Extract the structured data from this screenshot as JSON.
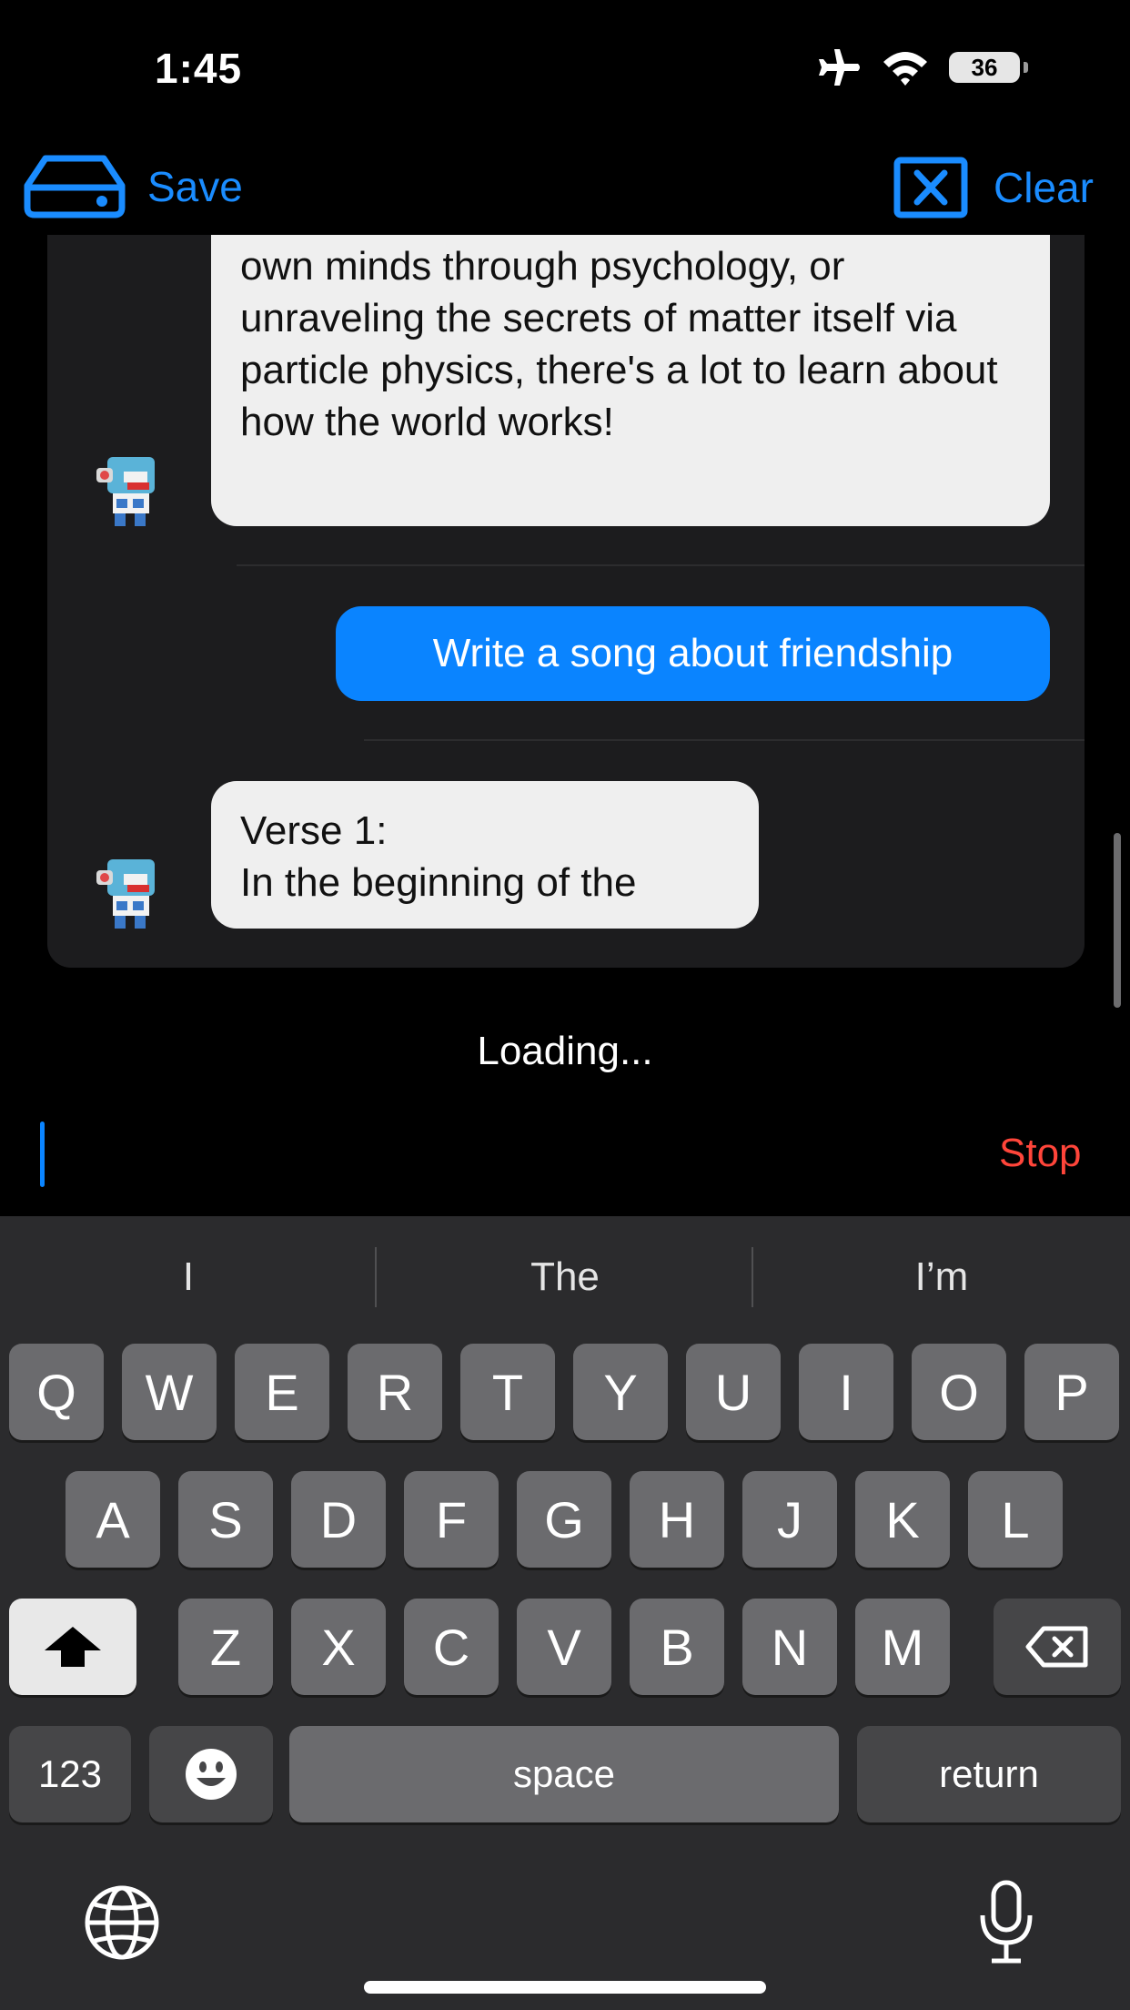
{
  "status_bar": {
    "time": "1:45",
    "battery": "36"
  },
  "nav": {
    "save_label": "Save",
    "clear_label": "Clear"
  },
  "messages": [
    {
      "role": "assistant",
      "text": "own minds through psychology, or unraveling the secrets of matter itself via particle physics, there's a lot to learn about how the world works!"
    },
    {
      "role": "user",
      "text": "Write a song about friendship"
    },
    {
      "role": "assistant",
      "text": "Verse 1: In the beginning of the",
      "lines": [
        "Verse 1:",
        "In the beginning of the"
      ]
    }
  ],
  "status": {
    "loading": "Loading..."
  },
  "input": {
    "stop_label": "Stop"
  },
  "keyboard": {
    "suggestions": [
      "I",
      "The",
      "I’m"
    ],
    "row1": [
      "Q",
      "W",
      "E",
      "R",
      "T",
      "Y",
      "U",
      "I",
      "O",
      "P"
    ],
    "row2": [
      "A",
      "S",
      "D",
      "F",
      "G",
      "H",
      "J",
      "K",
      "L"
    ],
    "row3": [
      "Z",
      "X",
      "C",
      "V",
      "B",
      "N",
      "M"
    ],
    "numbers_label": "123",
    "space_label": "space",
    "return_label": "return"
  },
  "colors": {
    "accent": "#0a84ff",
    "stop": "#ff453a",
    "user_bubble": "#0a84ff",
    "assistant_bubble": "#efefef"
  }
}
